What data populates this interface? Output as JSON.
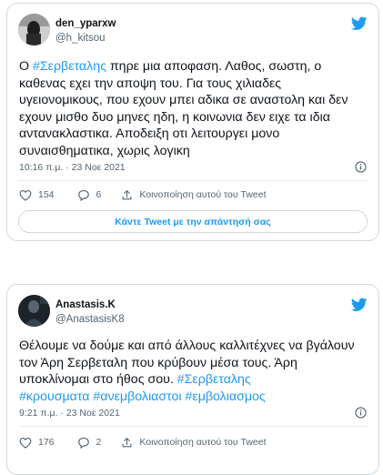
{
  "colors": {
    "accent": "#1d9bf0",
    "text": "#0f1419",
    "muted": "#536471",
    "border": "#cfd9de"
  },
  "tweets": [
    {
      "display_name": "den_yparxw",
      "handle": "@h_kitsou",
      "text_segments": [
        {
          "text": "Ο ",
          "hashtag": false
        },
        {
          "text": "#Σερβεταλης",
          "hashtag": true
        },
        {
          "text": " πηρε μια αποφαση. Λαθος, σωστη, ο καθενας εχει την αποψη του. Για τους χιλιαδες υγειονομικους, που εχουν μπει αδικα σε αναστολη και δεν εχουν μισθο δυο μηνες ηδη, η κοινωνια δεν ειχε τα ιδια αντανακλαστικα. Αποδειξη οτι λειτουργει μονο συναισθηματικα, χωρις λογικη",
          "hashtag": false
        }
      ],
      "timestamp": "10:16 π.μ. · 23 Νοε 2021",
      "likes": "154",
      "replies": "6",
      "share_label": "Κοινοποίηση αυτού του Tweet",
      "reply_button_label": "Κάντε Tweet με την απάντησή σας"
    },
    {
      "display_name": "Anastasis.K",
      "handle": "@AnastasisK8",
      "text_segments": [
        {
          "text": "Θέλουμε να δούμε και από άλλους καλλιτέχνες να βγάλουν τον Άρη Σερβεταλη που κρύβουν μέσα τους. Άρη υποκλίνομαι στο ήθος σου. ",
          "hashtag": false
        },
        {
          "text": "#Σερβεταλης",
          "hashtag": true
        },
        {
          "text": "\n",
          "hashtag": false
        },
        {
          "text": "#κρουσματα",
          "hashtag": true
        },
        {
          "text": " ",
          "hashtag": false
        },
        {
          "text": "#ανεμβολιαστοι",
          "hashtag": true
        },
        {
          "text": " ",
          "hashtag": false
        },
        {
          "text": "#εμβολιασμος",
          "hashtag": true
        }
      ],
      "timestamp": "9:21 π.μ. · 23 Νοε 2021",
      "likes": "176",
      "replies": "2",
      "share_label": "Κοινοποίηση αυτού του Tweet"
    }
  ]
}
